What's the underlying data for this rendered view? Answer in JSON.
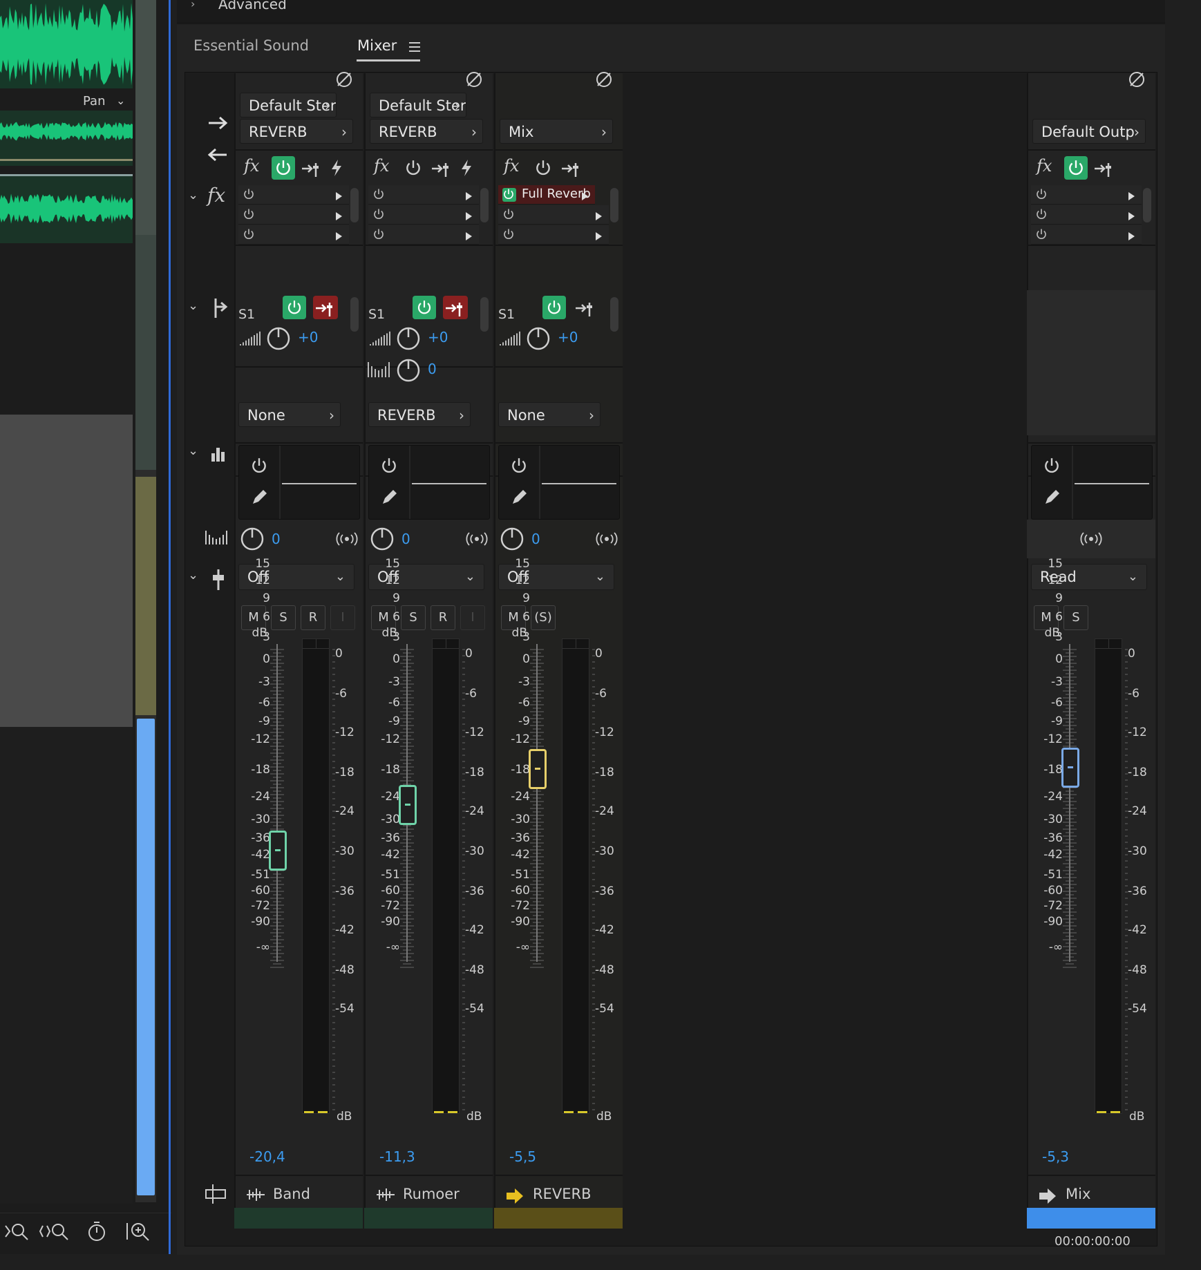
{
  "editor": {
    "pan_label": "Pan"
  },
  "panel": {
    "advanced_label": "Advanced",
    "tabs": [
      {
        "label": "Essential Sound"
      },
      {
        "label": "Mixer"
      }
    ]
  },
  "scale": {
    "left": [
      "dB",
      "15",
      "12",
      "9",
      "6",
      "3",
      "0",
      "-3",
      "-6",
      "-9",
      "-12",
      "-18",
      "-24",
      "-30",
      "-36",
      "-42",
      "-51",
      "-60",
      "-72",
      "-90",
      "-∞"
    ],
    "right": [
      "0",
      "-6",
      "-12",
      "-18",
      "-24",
      "-30",
      "-36",
      "-42",
      "-48",
      "-54",
      "dB"
    ]
  },
  "channels": [
    {
      "name": "Band",
      "output": "Default Stere",
      "input": "REVERB",
      "fx": [],
      "send_label": "S1",
      "send_level": "+0",
      "send_pan": "",
      "send_target": "None",
      "pan_value": "0",
      "automation": "Off",
      "buttons": [
        "M",
        "S",
        "R",
        "I"
      ],
      "db": "-20,4",
      "fader_db": -20.4,
      "color": "#1f3a2c",
      "fader_color": "#6fd3a9"
    },
    {
      "name": "Rumoer",
      "output": "Default Stere",
      "input": "REVERB",
      "fx": [],
      "send_label": "S1",
      "send_level": "+0",
      "send_pan": "0",
      "send_target": "REVERB",
      "pan_value": "0",
      "automation": "Off",
      "buttons": [
        "M",
        "S",
        "R",
        "I"
      ],
      "db": "-11,3",
      "fader_db": -11.3,
      "color": "#1f3a2c",
      "fader_color": "#6fd3a9"
    },
    {
      "name": "REVERB",
      "output": "",
      "input": "Mix",
      "fx": [
        "Full Reverb"
      ],
      "send_label": "S1",
      "send_level": "+0",
      "send_pan": "",
      "send_target": "None",
      "pan_value": "0",
      "automation": "Off",
      "buttons": [
        "M",
        "(S)"
      ],
      "db": "-5,5",
      "fader_db": -5.5,
      "color": "#5a4f18",
      "fader_color": "#e6cf6a"
    }
  ],
  "master": {
    "name": "Mix",
    "output": "Default Outp",
    "automation": "Read",
    "buttons": [
      "M",
      "S"
    ],
    "db": "-5,3",
    "fader_db": -5.3,
    "timecode": "00:00:00:00",
    "color": "#3e8eea",
    "fader_color": "#7aa9e6"
  }
}
